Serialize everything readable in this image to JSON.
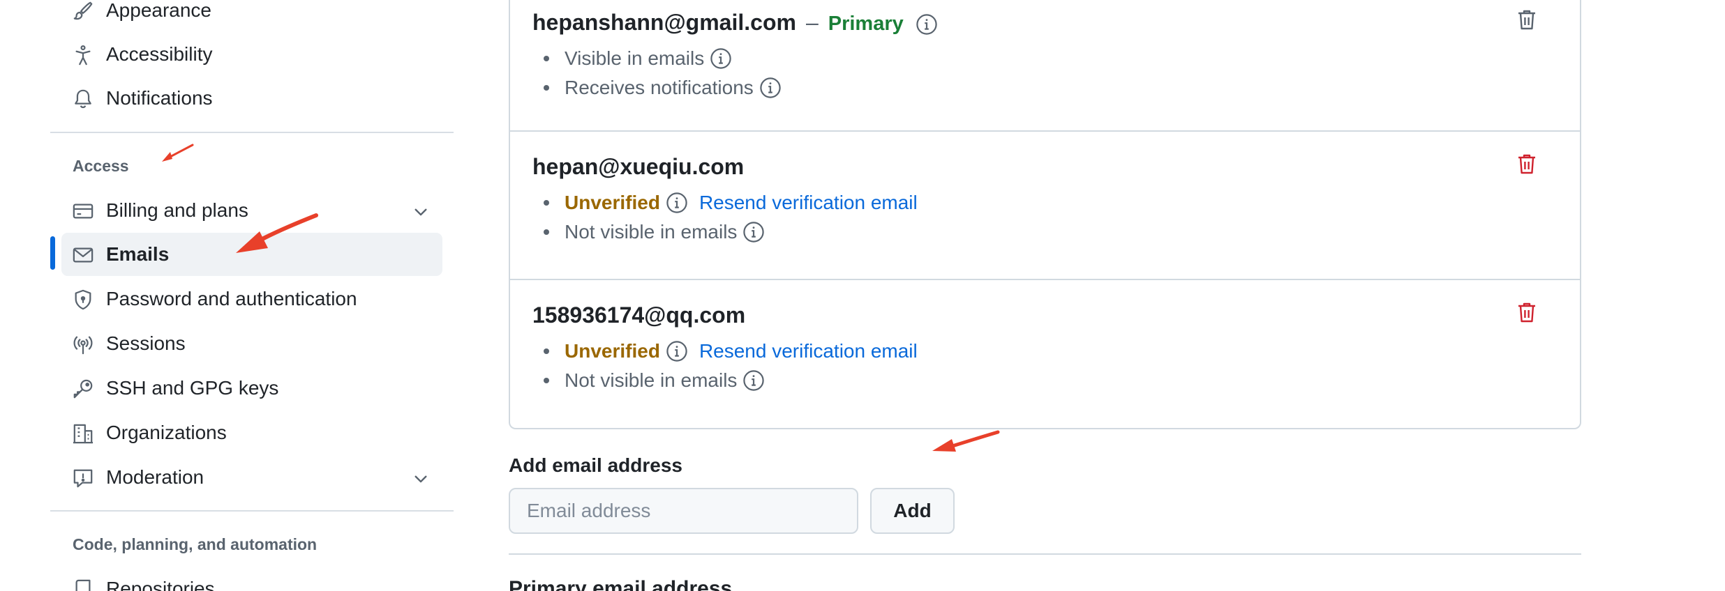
{
  "sidebar": {
    "items_top": [
      {
        "label": "Appearance",
        "icon": "paintbrush-icon"
      },
      {
        "label": "Accessibility",
        "icon": "accessibility-icon"
      },
      {
        "label": "Notifications",
        "icon": "bell-icon"
      }
    ],
    "access_heading": "Access",
    "items_access": [
      {
        "label": "Billing and plans",
        "icon": "credit-card-icon",
        "expandable": true
      },
      {
        "label": "Emails",
        "icon": "mail-icon",
        "active": true
      },
      {
        "label": "Password and authentication",
        "icon": "shield-lock-icon"
      },
      {
        "label": "Sessions",
        "icon": "broadcast-icon"
      },
      {
        "label": "SSH and GPG keys",
        "icon": "key-icon"
      },
      {
        "label": "Organizations",
        "icon": "organization-icon"
      },
      {
        "label": "Moderation",
        "icon": "report-icon",
        "expandable": true
      }
    ],
    "code_heading": "Code, planning, and automation",
    "items_code": [
      {
        "label": "Repositories",
        "icon": "repo-icon"
      }
    ]
  },
  "emails": [
    {
      "address": "hepanshann@gmail.com",
      "separator": "–",
      "badge": "Primary",
      "lines": [
        "Visible in emails",
        "Receives notifications"
      ]
    },
    {
      "address": "hepan@xueqiu.com",
      "status": "Unverified",
      "resend": "Resend verification email",
      "lines": [
        "Not visible in emails"
      ]
    },
    {
      "address": "158936174@qq.com",
      "status": "Unverified",
      "resend": "Resend verification email",
      "lines": [
        "Not visible in emails"
      ]
    }
  ],
  "add_email": {
    "label": "Add email address",
    "placeholder": "Email address",
    "button": "Add"
  },
  "primary_section": {
    "heading": "Primary email address"
  },
  "colors": {
    "accent": "#0969da",
    "success": "#1a7f37",
    "attention": "#9a6700",
    "danger": "#cf222e",
    "annotation": "#e8402a"
  }
}
